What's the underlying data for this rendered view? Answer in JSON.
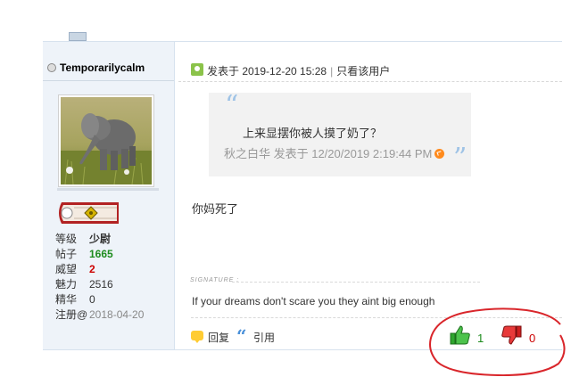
{
  "user": {
    "username": "Temporarilycalm",
    "stats": [
      {
        "label": "等级",
        "value": "少尉",
        "color": "#333333",
        "bold": true
      },
      {
        "label": "帖子",
        "value": "1665",
        "color": "#1e8c1e",
        "bold": true
      },
      {
        "label": "威望",
        "value": "2",
        "color": "#cc0000",
        "bold": true
      },
      {
        "label": "魅力",
        "value": "2516",
        "color": "#333333",
        "bold": false
      },
      {
        "label": "精华",
        "value": "0",
        "color": "#333333",
        "bold": false
      },
      {
        "label": "注册@",
        "value": "2018-04-20",
        "color": "#888888",
        "bold": false
      }
    ]
  },
  "post": {
    "posted_label": "发表于 2019-12-20 15:28",
    "only_author": "只看该用户",
    "quote": {
      "text": "上来显摆你被人摸了奶了？",
      "source": "秋之白华 发表于 12/20/2019 2:19:44 PM"
    },
    "message": "你妈死了",
    "signature_label": "SIGNATURE :",
    "signature": "If your dreams don't scare you they aint big enough"
  },
  "actions": {
    "reply": "回复",
    "quote": "引用",
    "like_count": "1",
    "dislike_count": "0"
  },
  "colors": {
    "like": "#1e8c1e",
    "dislike": "#cc0000",
    "annotation": "#d9262b"
  }
}
